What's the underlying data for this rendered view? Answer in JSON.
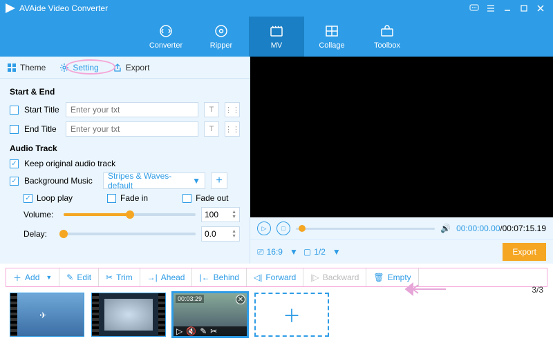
{
  "window": {
    "title": "AVAide Video Converter"
  },
  "nav": {
    "items": [
      {
        "label": "Converter"
      },
      {
        "label": "Ripper"
      },
      {
        "label": "MV"
      },
      {
        "label": "Collage"
      },
      {
        "label": "Toolbox"
      }
    ]
  },
  "tabs": {
    "theme": "Theme",
    "setting": "Setting",
    "export": "Export"
  },
  "startend": {
    "title": "Start & End",
    "start_label": "Start Title",
    "end_label": "End Title",
    "placeholder": "Enter your txt"
  },
  "audio": {
    "title": "Audio Track",
    "keep_label": "Keep original audio track",
    "bg_label": "Background Music",
    "bg_selected": "Stripes & Waves-default",
    "loop_label": "Loop play",
    "fadein_label": "Fade in",
    "fadeout_label": "Fade out",
    "volume_label": "Volume:",
    "volume_value": "100",
    "delay_label": "Delay:",
    "delay_value": "0.0"
  },
  "preview": {
    "time_current": "00:00:00.00",
    "time_total": "00:07:15.19",
    "aspect": "16:9",
    "page": "1/2",
    "export_label": "Export"
  },
  "toolbar": {
    "add": "Add",
    "edit": "Edit",
    "trim": "Trim",
    "ahead": "Ahead",
    "behind": "Behind",
    "forward": "Forward",
    "backward": "Backward",
    "empty": "Empty"
  },
  "counter": "3/3",
  "thumbs": {
    "t3_time": "00:03:29"
  }
}
